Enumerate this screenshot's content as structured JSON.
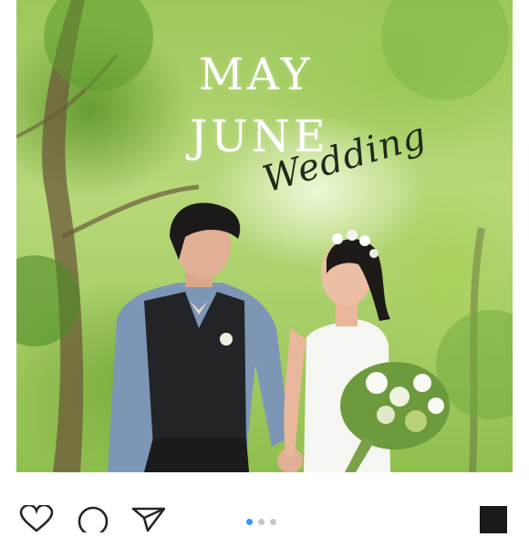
{
  "post": {
    "title_line1": "MAY",
    "title_line2": "JUNE",
    "title_script": "Wedding",
    "image_alt": "Couple walking hand in hand under green trees"
  },
  "actions": {
    "like_icon": "heart-icon",
    "comment_icon": "comment-icon",
    "share_icon": "paper-plane-icon",
    "save_icon": "bookmark-icon"
  },
  "carousel": {
    "total": 3,
    "active_index": 0
  },
  "colors": {
    "active_dot": "#3897f0",
    "inactive_dot": "#c7c7c7"
  }
}
